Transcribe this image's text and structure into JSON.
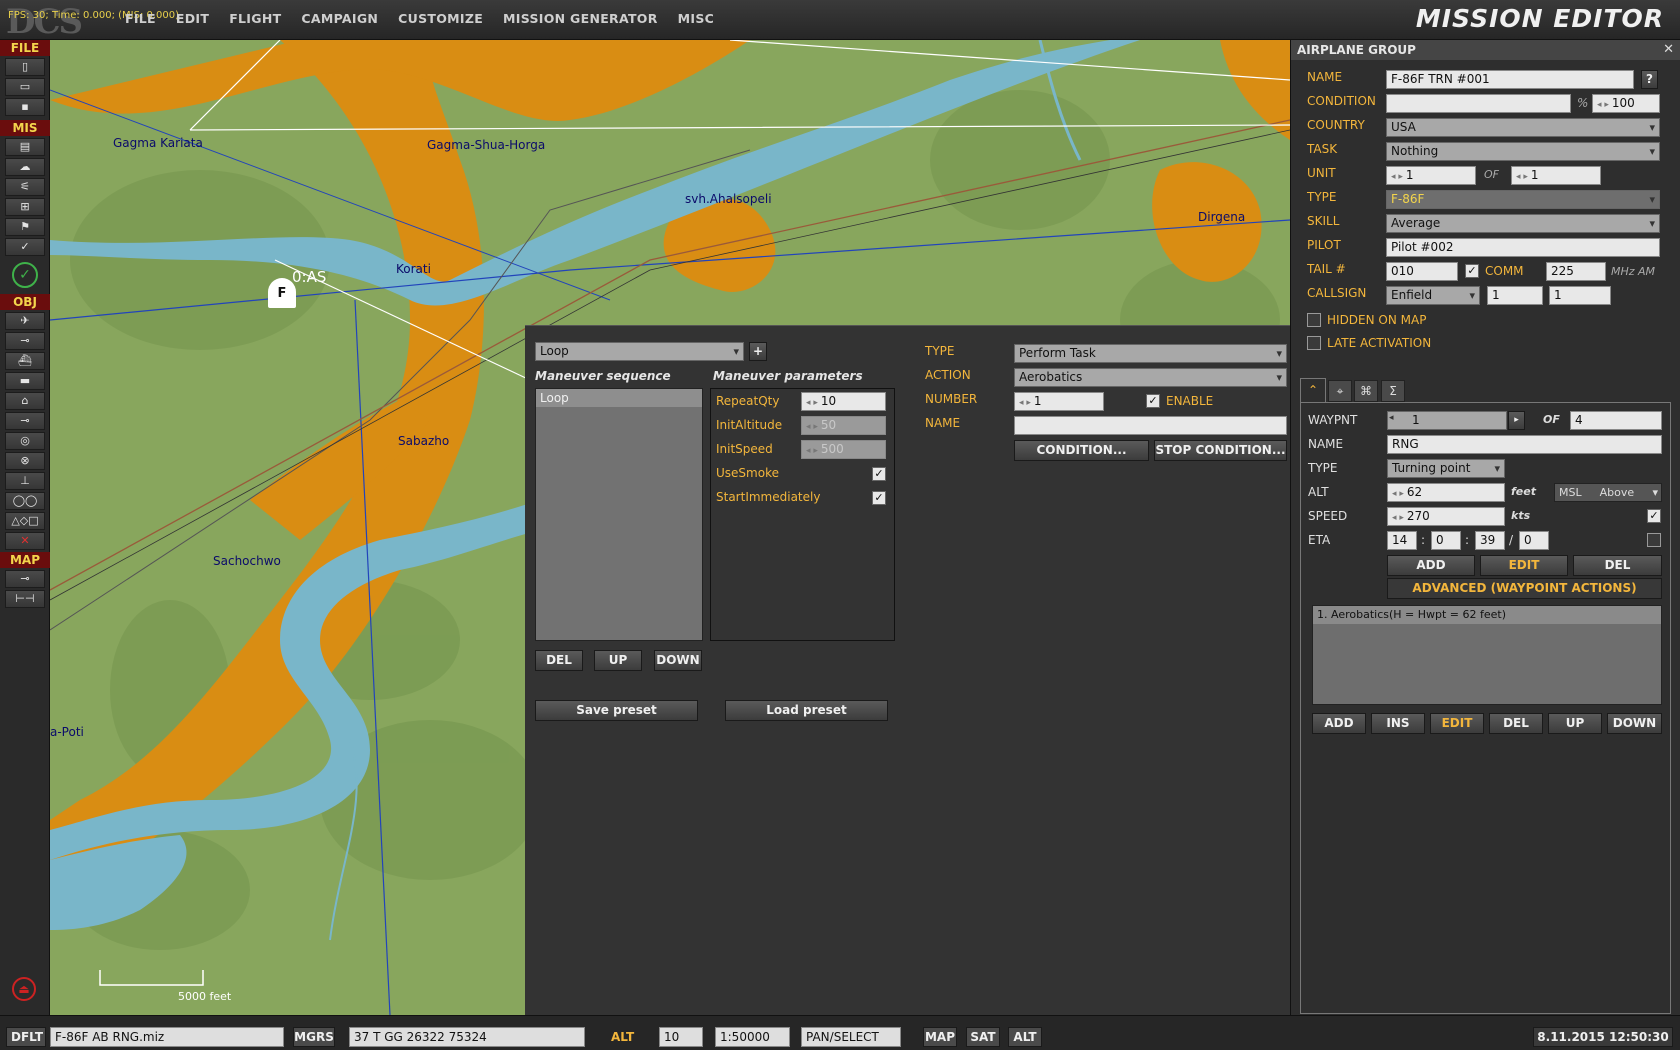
{
  "app": {
    "fps_text": "FPS: 30; Time: 0.000; (MIS: 0.000)",
    "title": "MISSION EDITOR",
    "logo": "DCS"
  },
  "menu": [
    {
      "label": "FILE"
    },
    {
      "label": "EDIT"
    },
    {
      "label": "FLIGHT"
    },
    {
      "label": "CAMPAIGN"
    },
    {
      "label": "CUSTOMIZE"
    },
    {
      "label": "MISSION GENERATOR"
    },
    {
      "label": "MISC"
    }
  ],
  "toolbar": {
    "file_label": "FILE",
    "mis_label": "MIS",
    "obj_label": "OBJ",
    "map_label": "MAP"
  },
  "map": {
    "towns": [
      {
        "name": "Gagma Kariata"
      },
      {
        "name": "Gagma-Shua-Horga"
      },
      {
        "name": "svh.Ahalsopeli"
      },
      {
        "name": "Dirgena"
      },
      {
        "name": "Korati"
      },
      {
        "name": "Sabazho"
      },
      {
        "name": "Sachochwo"
      },
      {
        "name": "a-Poti"
      }
    ],
    "unit_marker": "F",
    "unit_label": "0:AS",
    "scale_label": "5000 feet"
  },
  "maneuver": {
    "preset": "Loop",
    "add_glyph": "+",
    "sequence_title": "Maneuver sequence",
    "params_title": "Maneuver parameters",
    "sequence": [
      "Loop"
    ],
    "params": [
      {
        "name": "RepeatQty",
        "value": "10"
      },
      {
        "name": "InitAltitude",
        "value": "50"
      },
      {
        "name": "InitSpeed",
        "value": "500"
      },
      {
        "name": "UseSmoke",
        "checked": true
      },
      {
        "name": "StartImmediately",
        "checked": true
      }
    ],
    "del_label": "DEL",
    "up_label": "UP",
    "down_label": "DOWN",
    "save_label": "Save preset",
    "load_label": "Load preset"
  },
  "task": {
    "type_label": "TYPE",
    "type_value": "Perform Task",
    "action_label": "ACTION",
    "action_value": "Aerobatics",
    "number_label": "NUMBER",
    "number_value": "1",
    "enable_label": "ENABLE",
    "name_label": "NAME",
    "name_value": "",
    "condition_label": "CONDITION...",
    "stop_condition_label": "STOP CONDITION..."
  },
  "group": {
    "header": "AIRPLANE GROUP",
    "close": "✕",
    "name_label": "NAME",
    "name_value": "F-86F TRN #001",
    "help": "?",
    "condition_label": "CONDITION",
    "condition_value": "",
    "pct": "%",
    "prob": "100",
    "country_label": "COUNTRY",
    "country_value": "USA",
    "task_label": "TASK",
    "task_value": "Nothing",
    "unit_label": "UNIT",
    "unit_value": "1",
    "of_label": "OF",
    "unit_of": "1",
    "type_label": "TYPE",
    "type_value": "F-86F",
    "skill_label": "SKILL",
    "skill_value": "Average",
    "pilot_label": "PILOT",
    "pilot_value": "Pilot #002",
    "tail_label": "TAIL #",
    "tail_value": "010",
    "comm_label": "COMM",
    "comm_value": "225",
    "mhz": "MHz AM",
    "callsign_label": "CALLSIGN",
    "callsign_value": "Enfield",
    "callsign_n1": "1",
    "callsign_n2": "1",
    "hidden_label": "HIDDEN ON MAP",
    "late_label": "LATE ACTIVATION"
  },
  "waypoint": {
    "wp_label": "WAYPNT",
    "wp_value": "1",
    "of_label": "OF",
    "of_value": "4",
    "name_label": "NAME",
    "name_value": "RNG",
    "type_label": "TYPE",
    "type_value": "Turning point",
    "alt_label": "ALT",
    "alt_value": "62",
    "alt_unit": "feet",
    "alt_ref": "MSL",
    "alt_mode": "Above",
    "speed_label": "SPEED",
    "speed_value": "270",
    "speed_unit": "kts",
    "eta_label": "ETA",
    "eta": [
      "14",
      "0",
      "39",
      "0"
    ],
    "add_label": "ADD",
    "edit_label": "EDIT",
    "del_label": "DEL",
    "advanced_label": "ADVANCED (WAYPOINT ACTIONS)",
    "actions": [
      "1. Aerobatics(H = Hwpt = 62 feet)"
    ],
    "bottom_buttons": [
      "ADD",
      "INS",
      "EDIT",
      "DEL",
      "UP",
      "DOWN"
    ]
  },
  "status": {
    "mode": "DFLT",
    "file": "F-86F AB RNG.miz",
    "coord_type": "MGRS",
    "coords": "37 T GG 26322 75324",
    "alt_label": "ALT",
    "alt_value": "10",
    "scale": "1:50000",
    "tool": "PAN/SELECT",
    "map_btn": "MAP",
    "sat_btn": "SAT",
    "alt_btn": "ALT",
    "datetime": "8.11.2015 12:50:30"
  }
}
